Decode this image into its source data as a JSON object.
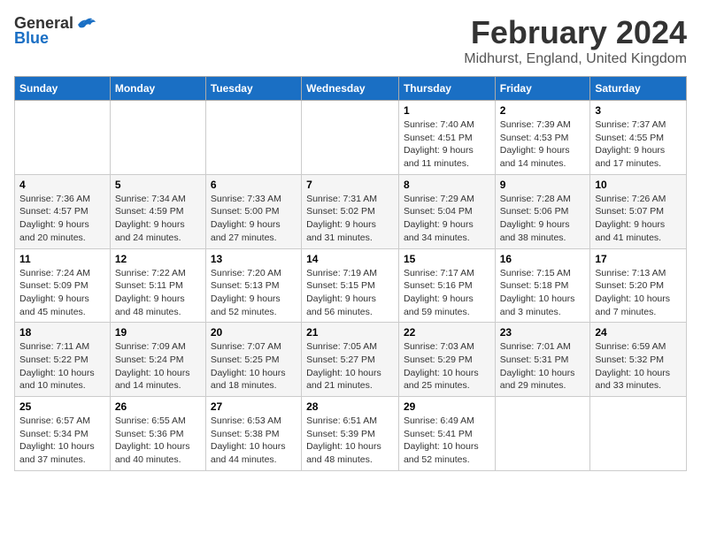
{
  "logo": {
    "general": "General",
    "blue": "Blue"
  },
  "title": "February 2024",
  "subtitle": "Midhurst, England, United Kingdom",
  "weekdays": [
    "Sunday",
    "Monday",
    "Tuesday",
    "Wednesday",
    "Thursday",
    "Friday",
    "Saturday"
  ],
  "weeks": [
    [
      {
        "day": "",
        "info": ""
      },
      {
        "day": "",
        "info": ""
      },
      {
        "day": "",
        "info": ""
      },
      {
        "day": "",
        "info": ""
      },
      {
        "day": "1",
        "info": "Sunrise: 7:40 AM\nSunset: 4:51 PM\nDaylight: 9 hours and 11 minutes."
      },
      {
        "day": "2",
        "info": "Sunrise: 7:39 AM\nSunset: 4:53 PM\nDaylight: 9 hours and 14 minutes."
      },
      {
        "day": "3",
        "info": "Sunrise: 7:37 AM\nSunset: 4:55 PM\nDaylight: 9 hours and 17 minutes."
      }
    ],
    [
      {
        "day": "4",
        "info": "Sunrise: 7:36 AM\nSunset: 4:57 PM\nDaylight: 9 hours and 20 minutes."
      },
      {
        "day": "5",
        "info": "Sunrise: 7:34 AM\nSunset: 4:59 PM\nDaylight: 9 hours and 24 minutes."
      },
      {
        "day": "6",
        "info": "Sunrise: 7:33 AM\nSunset: 5:00 PM\nDaylight: 9 hours and 27 minutes."
      },
      {
        "day": "7",
        "info": "Sunrise: 7:31 AM\nSunset: 5:02 PM\nDaylight: 9 hours and 31 minutes."
      },
      {
        "day": "8",
        "info": "Sunrise: 7:29 AM\nSunset: 5:04 PM\nDaylight: 9 hours and 34 minutes."
      },
      {
        "day": "9",
        "info": "Sunrise: 7:28 AM\nSunset: 5:06 PM\nDaylight: 9 hours and 38 minutes."
      },
      {
        "day": "10",
        "info": "Sunrise: 7:26 AM\nSunset: 5:07 PM\nDaylight: 9 hours and 41 minutes."
      }
    ],
    [
      {
        "day": "11",
        "info": "Sunrise: 7:24 AM\nSunset: 5:09 PM\nDaylight: 9 hours and 45 minutes."
      },
      {
        "day": "12",
        "info": "Sunrise: 7:22 AM\nSunset: 5:11 PM\nDaylight: 9 hours and 48 minutes."
      },
      {
        "day": "13",
        "info": "Sunrise: 7:20 AM\nSunset: 5:13 PM\nDaylight: 9 hours and 52 minutes."
      },
      {
        "day": "14",
        "info": "Sunrise: 7:19 AM\nSunset: 5:15 PM\nDaylight: 9 hours and 56 minutes."
      },
      {
        "day": "15",
        "info": "Sunrise: 7:17 AM\nSunset: 5:16 PM\nDaylight: 9 hours and 59 minutes."
      },
      {
        "day": "16",
        "info": "Sunrise: 7:15 AM\nSunset: 5:18 PM\nDaylight: 10 hours and 3 minutes."
      },
      {
        "day": "17",
        "info": "Sunrise: 7:13 AM\nSunset: 5:20 PM\nDaylight: 10 hours and 7 minutes."
      }
    ],
    [
      {
        "day": "18",
        "info": "Sunrise: 7:11 AM\nSunset: 5:22 PM\nDaylight: 10 hours and 10 minutes."
      },
      {
        "day": "19",
        "info": "Sunrise: 7:09 AM\nSunset: 5:24 PM\nDaylight: 10 hours and 14 minutes."
      },
      {
        "day": "20",
        "info": "Sunrise: 7:07 AM\nSunset: 5:25 PM\nDaylight: 10 hours and 18 minutes."
      },
      {
        "day": "21",
        "info": "Sunrise: 7:05 AM\nSunset: 5:27 PM\nDaylight: 10 hours and 21 minutes."
      },
      {
        "day": "22",
        "info": "Sunrise: 7:03 AM\nSunset: 5:29 PM\nDaylight: 10 hours and 25 minutes."
      },
      {
        "day": "23",
        "info": "Sunrise: 7:01 AM\nSunset: 5:31 PM\nDaylight: 10 hours and 29 minutes."
      },
      {
        "day": "24",
        "info": "Sunrise: 6:59 AM\nSunset: 5:32 PM\nDaylight: 10 hours and 33 minutes."
      }
    ],
    [
      {
        "day": "25",
        "info": "Sunrise: 6:57 AM\nSunset: 5:34 PM\nDaylight: 10 hours and 37 minutes."
      },
      {
        "day": "26",
        "info": "Sunrise: 6:55 AM\nSunset: 5:36 PM\nDaylight: 10 hours and 40 minutes."
      },
      {
        "day": "27",
        "info": "Sunrise: 6:53 AM\nSunset: 5:38 PM\nDaylight: 10 hours and 44 minutes."
      },
      {
        "day": "28",
        "info": "Sunrise: 6:51 AM\nSunset: 5:39 PM\nDaylight: 10 hours and 48 minutes."
      },
      {
        "day": "29",
        "info": "Sunrise: 6:49 AM\nSunset: 5:41 PM\nDaylight: 10 hours and 52 minutes."
      },
      {
        "day": "",
        "info": ""
      },
      {
        "day": "",
        "info": ""
      }
    ]
  ]
}
